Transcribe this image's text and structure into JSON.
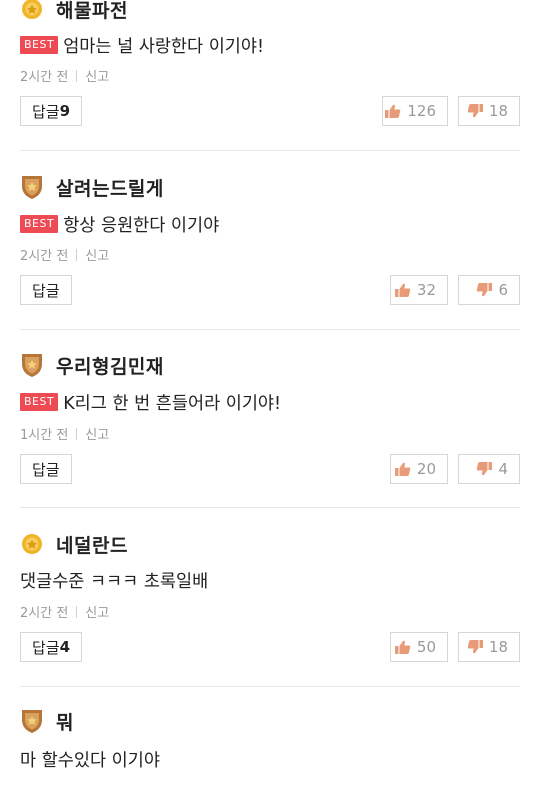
{
  "labels": {
    "best": "BEST",
    "reply": "답글",
    "report": "신고"
  },
  "colors": {
    "best_badge": "#ee4a54",
    "gold_badge": "#f0b429",
    "bronze_badge": "#b5743a",
    "thumb": "#e89b78"
  },
  "comments": [
    {
      "nickname": "해물파전",
      "badge_icon": "gold-medal-icon",
      "best": true,
      "text": "엄마는 널 사랑한다 이기야!",
      "time": "2시간 전",
      "reply_count": "9",
      "likes": "126",
      "dislikes": "18"
    },
    {
      "nickname": "살려는드릴게",
      "badge_icon": "bronze-shield-icon",
      "best": true,
      "text": "항상 응원한다 이기야",
      "time": "2시간 전",
      "reply_count": "",
      "likes": "32",
      "dislikes": "6"
    },
    {
      "nickname": "우리형김민재",
      "badge_icon": "bronze-shield-icon",
      "best": true,
      "text": "K리그 한 번 흔들어라 이기야!",
      "time": "1시간 전",
      "reply_count": "",
      "likes": "20",
      "dislikes": "4"
    },
    {
      "nickname": "네덜란드",
      "badge_icon": "gold-medal-icon",
      "best": false,
      "text": "댓글수준 ㅋㅋㅋ 초록일배",
      "time": "2시간 전",
      "reply_count": "4",
      "likes": "50",
      "dislikes": "18"
    },
    {
      "nickname": "뭐",
      "badge_icon": "bronze-shield-icon",
      "best": false,
      "text": "마 할수있다 이기야"
    }
  ]
}
